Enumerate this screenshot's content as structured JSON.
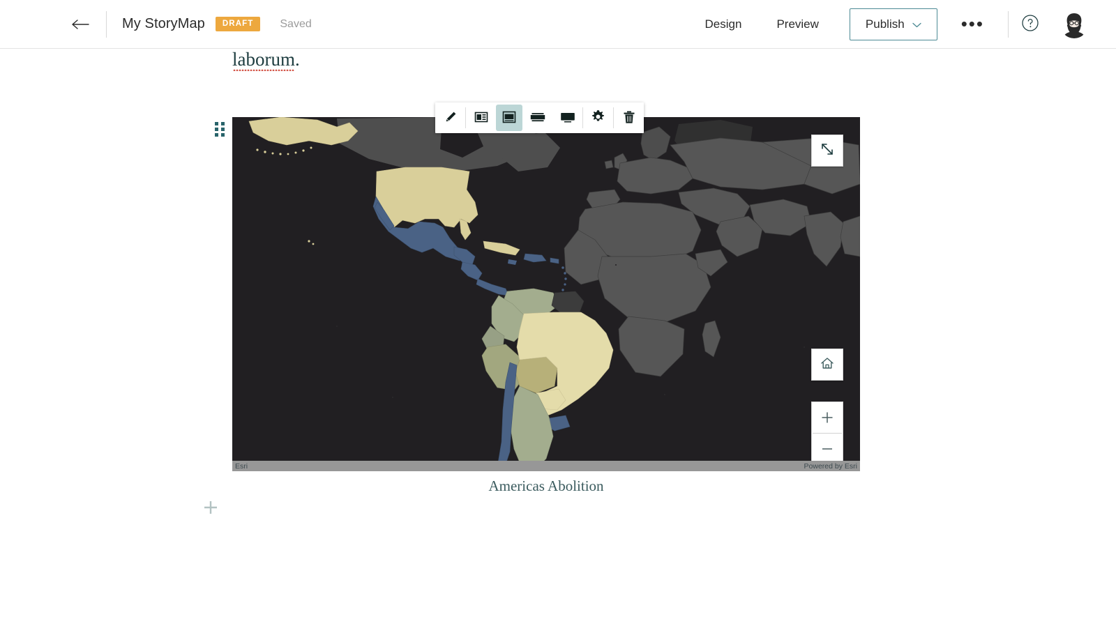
{
  "header": {
    "back_icon": "arrow-left-icon",
    "title": "My StoryMap",
    "draft_badge": "DRAFT",
    "save_status": "Saved",
    "design_label": "Design",
    "preview_label": "Preview",
    "publish_label": "Publish",
    "publish_caret_icon": "chevron-down-icon",
    "more_label": "•••",
    "help_icon": "question-circle-icon",
    "avatar_icon": "user-avatar",
    "accent_color": "#4c8a94",
    "draft_color": "#eda83e"
  },
  "body": {
    "paragraph_tail": "laborum.",
    "spellcheck_color": "#d4574a"
  },
  "block_toolbar": {
    "buttons": [
      {
        "name": "edit-map-button",
        "icon": "pencil-icon",
        "label": "Edit",
        "selected": false
      },
      {
        "name": "size-small-button",
        "icon": "layout-small-icon",
        "label": "Small",
        "selected": false
      },
      {
        "name": "size-medium-button",
        "icon": "layout-medium-icon",
        "label": "Medium",
        "selected": true
      },
      {
        "name": "size-large-button",
        "icon": "layout-large-icon",
        "label": "Large",
        "selected": false
      },
      {
        "name": "size-full-button",
        "icon": "layout-full-icon",
        "label": "Full",
        "selected": false
      },
      {
        "name": "map-settings-button",
        "icon": "gear-icon",
        "label": "Options",
        "selected": false
      },
      {
        "name": "delete-block-button",
        "icon": "trash-icon",
        "label": "Delete",
        "selected": false
      }
    ]
  },
  "map_block": {
    "drag_handle_icon": "drag-dots-icon",
    "expand_icon": "expand-arrows-icon",
    "home_icon": "home-icon",
    "zoom_in_label": "+",
    "zoom_out_label": "−",
    "attribution_left": "Esri",
    "attribution_right": "Powered by Esri",
    "caption": "Americas Abolition",
    "basemap_ocean_color": "#211f22",
    "basemap_land_color": "#565656",
    "symbol_colors": {
      "khaki": "#d9cf9a",
      "light_khaki": "#e4dcaa",
      "steel_blue": "#4a6285",
      "sage": "#a3ad8e",
      "olive": "#b7b079",
      "dark_gray": "#3c3c3c"
    }
  },
  "add_block": {
    "icon": "plus-icon",
    "label": "Add block",
    "color": "#b3c2c2"
  }
}
